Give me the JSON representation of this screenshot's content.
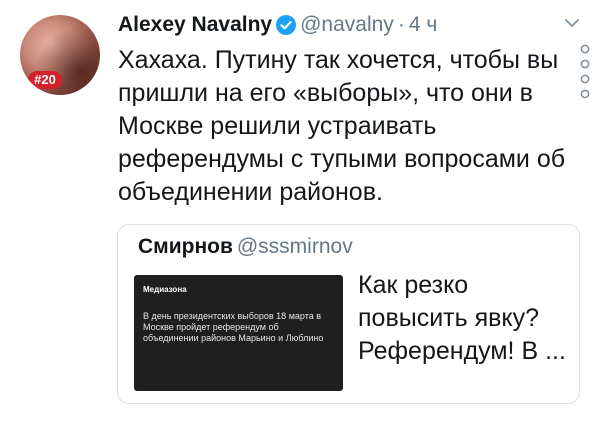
{
  "tweet": {
    "author_name": "Alexey Navalny",
    "handle": "@navalny",
    "separator": "·",
    "time": "4 ч",
    "avatar_badge": "#20",
    "text": "Хахаха. Путину так хочется, чтобы вы пришли на его «выборы», что они в Москве решили устраивать референдумы с тупыми вопросами об объединении районов."
  },
  "quote": {
    "author_name": "Смирнов",
    "handle": "@sssmirnov",
    "media_brand": "Медиазона",
    "media_caption": "В день президентских выборов 18 марта в Москве пройдет референдум об объединении районов Марьино и Люблино",
    "text": "Как резко повысить явку? Референдум! В ..."
  },
  "colors": {
    "text": "#14171a",
    "secondary": "#657786",
    "verified": "#1da1f2",
    "badge": "#d3202a",
    "border": "#d8dfe5"
  },
  "icons": {
    "verified": "verified-badge-icon",
    "chevron": "chevron-down-icon",
    "more": "vertical-dots-icon"
  }
}
